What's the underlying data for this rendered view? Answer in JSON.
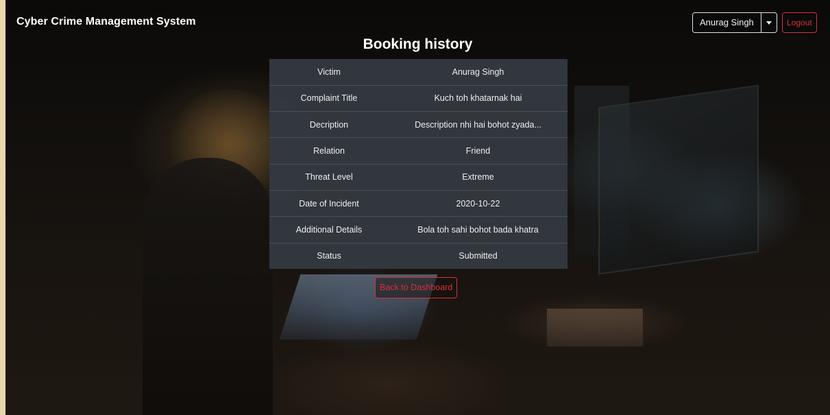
{
  "navbar": {
    "brand": "Cyber Crime Management System",
    "user_name": "Anurag Singh",
    "logout_label": "Logout"
  },
  "page": {
    "title": "Booking history",
    "back_label": "Back to Dashboard"
  },
  "details": [
    {
      "label": "Victim",
      "value": "Anurag Singh"
    },
    {
      "label": "Complaint Title",
      "value": "Kuch toh khatarnak hai"
    },
    {
      "label": "Decription",
      "value": "Description nhi hai bohot zyada..."
    },
    {
      "label": "Relation",
      "value": "Friend"
    },
    {
      "label": "Threat Level",
      "value": "Extreme"
    },
    {
      "label": "Date of Incident",
      "value": "2020-10-22"
    },
    {
      "label": "Additional Details",
      "value": "Bola toh sahi bohot bada khatra"
    },
    {
      "label": "Status",
      "value": "Submitted"
    }
  ],
  "colors": {
    "accent_danger": "#d7303c",
    "table_bg": "#343940",
    "text": "#ffffff"
  },
  "icons": {
    "user_dropdown": "caret-down-icon"
  }
}
